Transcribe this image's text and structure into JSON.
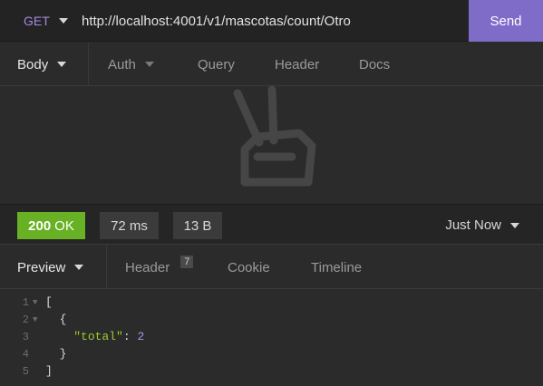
{
  "url_bar": {
    "method": "GET",
    "url": "http://localhost:4001/v1/mascotas/count/Otro",
    "send_label": "Send"
  },
  "request_tabs": [
    {
      "label": "Body",
      "active": true,
      "has_dropdown": true
    },
    {
      "label": "Auth",
      "active": false,
      "has_dropdown": true
    },
    {
      "label": "Query",
      "active": false,
      "has_dropdown": false
    },
    {
      "label": "Header",
      "active": false,
      "has_dropdown": false
    },
    {
      "label": "Docs",
      "active": false,
      "has_dropdown": false
    }
  ],
  "empty_state_icon": "peace-hand-icon",
  "response": {
    "status_code": "200",
    "status_text": "OK",
    "time": "72 ms",
    "size": "13 B",
    "history_label": "Just Now",
    "status_color": "#68b024"
  },
  "response_tabs": [
    {
      "label": "Preview",
      "active": true,
      "has_dropdown": true
    },
    {
      "label": "Header",
      "count": "7",
      "active": false
    },
    {
      "label": "Cookie",
      "active": false
    },
    {
      "label": "Timeline",
      "active": false
    }
  ],
  "code_lines": [
    {
      "number": "1",
      "fold": "▼",
      "text": "["
    },
    {
      "number": "2",
      "fold": "▼",
      "text": "  {"
    },
    {
      "number": "3",
      "fold": "",
      "key": "\"total\"",
      "sep": ": ",
      "value": "2"
    },
    {
      "number": "4",
      "fold": "",
      "text": "  }"
    },
    {
      "number": "5",
      "fold": "",
      "text": "]"
    }
  ],
  "colors": {
    "accent": "#7e6cc8",
    "method": "#a48be0",
    "json_key": "#9ccc2c",
    "json_number": "#ad8ee6"
  }
}
